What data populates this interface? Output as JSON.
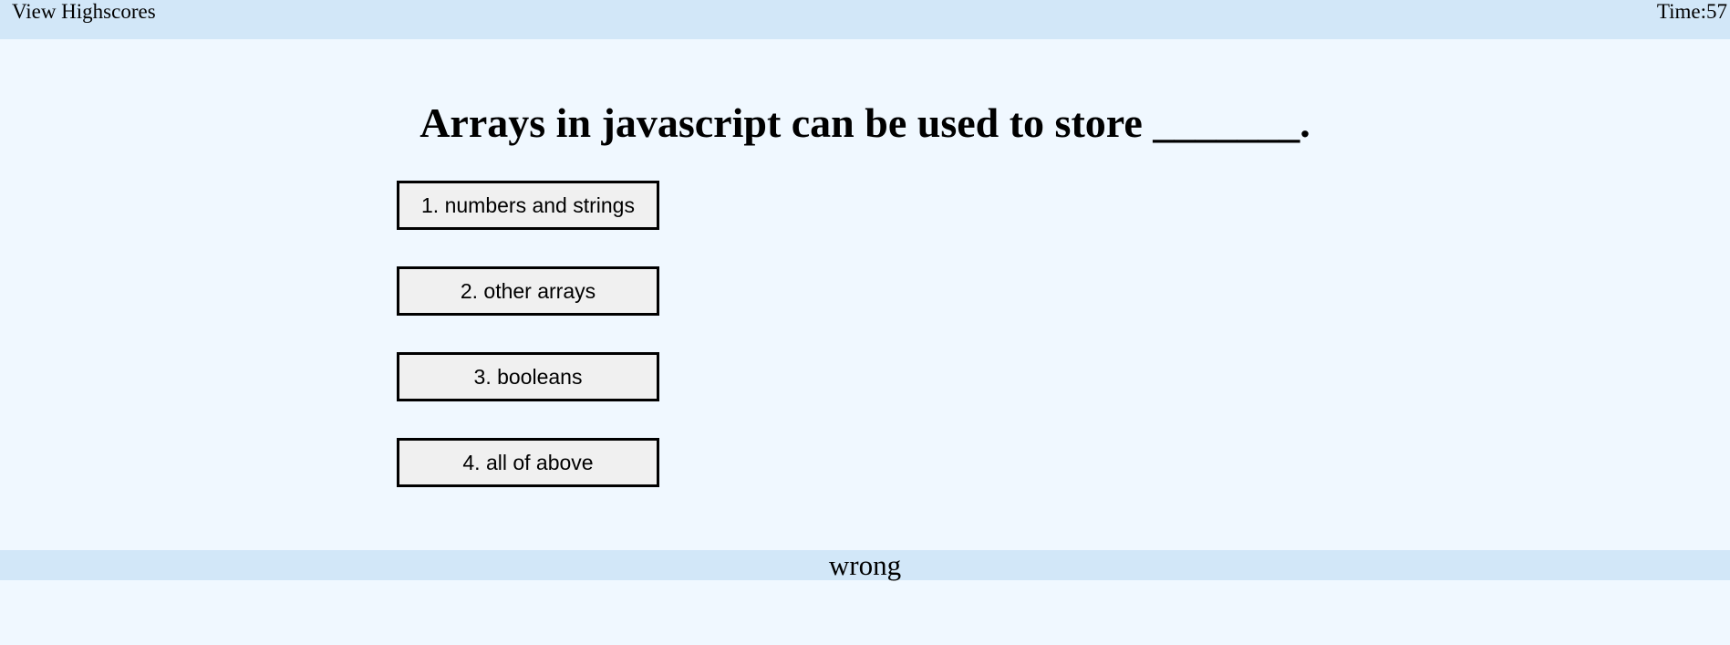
{
  "header": {
    "highscores_link": "View Highscores",
    "timer": "Time:57"
  },
  "quiz": {
    "question": "Arrays in javascript can be used to store _______.",
    "answers": [
      {
        "label": "1. numbers and strings"
      },
      {
        "label": "2. other arrays"
      },
      {
        "label": "3. booleans"
      },
      {
        "label": "4. all of above"
      }
    ]
  },
  "feedback": {
    "text": "wrong"
  },
  "colors": {
    "page_background": "#f0f8ff",
    "bar_background": "#d2e7f8",
    "button_background": "#f0f0f0",
    "button_border": "#000000"
  }
}
